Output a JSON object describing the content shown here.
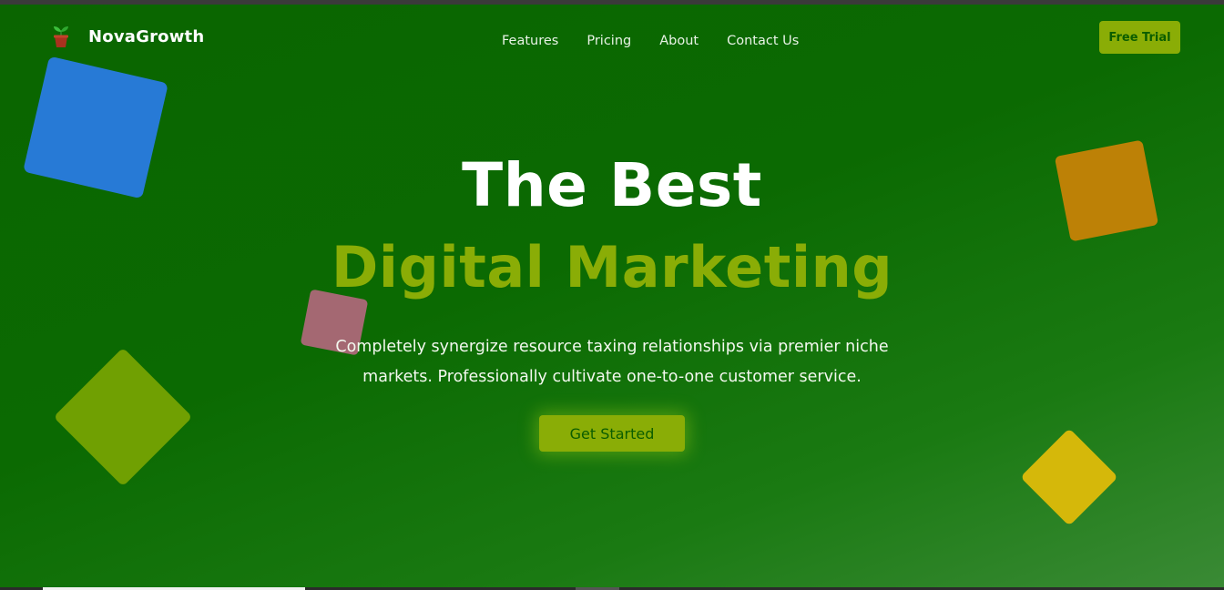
{
  "brand": {
    "name": "NovaGrowth",
    "logo_icon": "potted-plant-icon"
  },
  "nav": {
    "links": [
      "Features",
      "Pricing",
      "About",
      "Contact Us"
    ],
    "cta_label": "Free Trial"
  },
  "hero": {
    "headline_line1": "The Best",
    "headline_line2": "Digital Marketing",
    "subtext": "Completely synergize resource taxing relationships via premier niche markets. Professionally cultivate one-to-one customer service.",
    "cta_label": "Get Started"
  },
  "colors": {
    "background": "#0a6500",
    "accent": "#8aad06",
    "shape_blue": "#277ad6",
    "shape_orange": "#bd8106",
    "shape_pink": "#a46872",
    "shape_olive": "#70a002",
    "shape_yellow": "#d5b80a"
  }
}
